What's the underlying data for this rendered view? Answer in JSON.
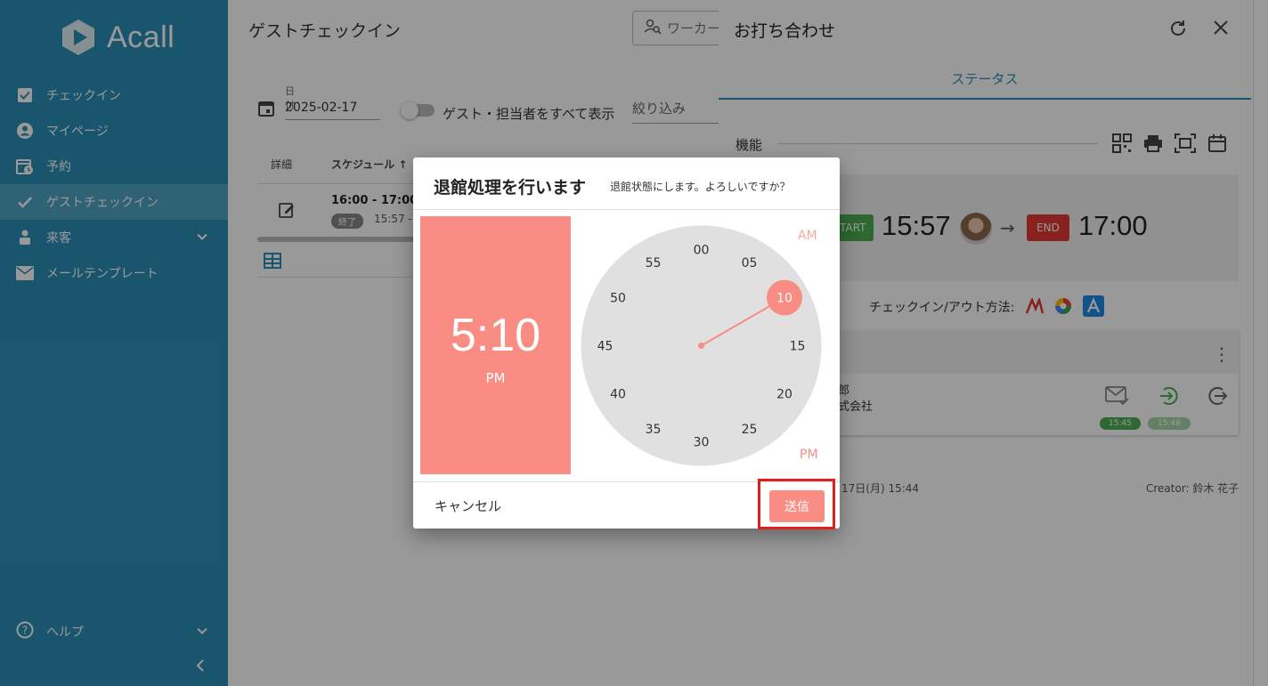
{
  "sidebar": {
    "logo_text": "Acall",
    "items": [
      {
        "label": "チェックイン"
      },
      {
        "label": "マイページ"
      },
      {
        "label": "予約"
      },
      {
        "label": "ゲストチェックイン"
      },
      {
        "label": "来客"
      },
      {
        "label": "メールテンプレート"
      }
    ],
    "help_label": "ヘルプ"
  },
  "main": {
    "title": "ゲストチェックイン",
    "search_placeholder": "ワーカー",
    "date_label": "日付",
    "date_value": "2025-02-17",
    "toggle_label": "ゲスト・担当者をすべて表示",
    "filter_label": "絞り込み",
    "col_detail": "詳細",
    "col_schedule": "スケジュール ↑",
    "row": {
      "time": "16:00 - 17:00",
      "badge": "終了",
      "sub": "15:57 -"
    }
  },
  "drawer": {
    "title": "お打ち合わせ",
    "tab_status": "ステータス",
    "features_label": "機能",
    "start_badge": "START",
    "start_time": "15:57",
    "end_badge": "END",
    "end_time": "17:00",
    "checkin_method_label": "チェックイン/アウト方法:",
    "guest_name": "郎",
    "guest_company": "式会社",
    "chip_mail": "15:45",
    "chip_in": "15:48",
    "created": "17日(月) 15:44",
    "creator": "Creator: 鈴木 花子"
  },
  "dialog": {
    "title": "退館処理を行います",
    "subtitle": "退館状態にします。よろしいですか？",
    "time_display": "5:10",
    "ampm_display": "PM",
    "am_label": "AM",
    "pm_label": "PM",
    "minute_labels": [
      "00",
      "05",
      "10",
      "15",
      "20",
      "25",
      "30",
      "35",
      "40",
      "45",
      "50",
      "55"
    ],
    "selected_minute": "10",
    "cancel_label": "キャンセル",
    "send_label": "送信"
  },
  "colors": {
    "sidebar_bg": "#2b8fb6",
    "accent": "#f98d83",
    "start_green": "#4caf50",
    "end_red": "#e53935",
    "highlight_red": "#e02020"
  }
}
